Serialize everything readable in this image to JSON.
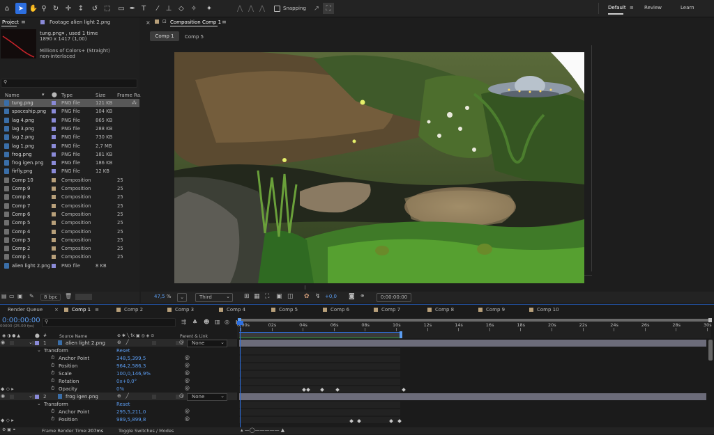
{
  "toolbar": {
    "snapping_label": "Snapping",
    "workspaces": [
      "Default",
      "Review",
      "Learn"
    ],
    "tools": [
      "home-icon",
      "selection-icon",
      "hand-icon",
      "zoom-icon",
      "orbit-icon",
      "move-icon",
      "dolly-icon",
      "rotate-icon",
      "marquee-icon",
      "rectangle-icon",
      "pen-icon",
      "type-icon",
      "brush-icon",
      "clone-icon",
      "eraser-icon",
      "roto-icon",
      "puppet-icon"
    ]
  },
  "project": {
    "title": "Project",
    "footage_tab": "Footage alien light 2.png",
    "info_name": "tung.png▾ , used 1 time",
    "info_dims": "1890 x 1417 (1,00)",
    "info_colors": "Millions of Colors+ (Straight)",
    "info_interlace": "non-interlaced",
    "search_placeholder": "",
    "columns": {
      "name": "Name",
      "type": "Type",
      "size": "Size",
      "frame_rate": "Frame Ra..."
    },
    "items": [
      {
        "name": "tung.png",
        "type": "PNG file",
        "size": "121 KB",
        "color": "#8a8ad8",
        "kind": "file",
        "selected": true
      },
      {
        "name": "spaceship.png",
        "type": "PNG file",
        "size": "104 KB",
        "color": "#8a8ad8",
        "kind": "file"
      },
      {
        "name": "lag 4.png",
        "type": "PNG file",
        "size": "865 KB",
        "color": "#8a8ad8",
        "kind": "file"
      },
      {
        "name": "lag 3.png",
        "type": "PNG file",
        "size": "288 KB",
        "color": "#8a8ad8",
        "kind": "file"
      },
      {
        "name": "lag 2.png",
        "type": "PNG file",
        "size": "730 KB",
        "color": "#8a8ad8",
        "kind": "file"
      },
      {
        "name": "lag 1.png",
        "type": "PNG file",
        "size": "2,7 MB",
        "color": "#8a8ad8",
        "kind": "file"
      },
      {
        "name": "frog.png",
        "type": "PNG file",
        "size": "181 KB",
        "color": "#8a8ad8",
        "kind": "file"
      },
      {
        "name": "frog igen.png",
        "type": "PNG file",
        "size": "186 KB",
        "color": "#8a8ad8",
        "kind": "file"
      },
      {
        "name": "firfly.png",
        "type": "PNG file",
        "size": "12 KB",
        "color": "#8a8ad8",
        "kind": "file"
      },
      {
        "name": "Comp 10",
        "type": "Composition",
        "size": "",
        "fps": "25",
        "color": "#b8a07a",
        "kind": "comp"
      },
      {
        "name": "Comp 9",
        "type": "Composition",
        "size": "",
        "fps": "25",
        "color": "#b8a07a",
        "kind": "comp"
      },
      {
        "name": "Comp 8",
        "type": "Composition",
        "size": "",
        "fps": "25",
        "color": "#b8a07a",
        "kind": "comp"
      },
      {
        "name": "Comp 7",
        "type": "Composition",
        "size": "",
        "fps": "25",
        "color": "#b8a07a",
        "kind": "comp"
      },
      {
        "name": "Comp 6",
        "type": "Composition",
        "size": "",
        "fps": "25",
        "color": "#b8a07a",
        "kind": "comp"
      },
      {
        "name": "Comp 5",
        "type": "Composition",
        "size": "",
        "fps": "25",
        "color": "#b8a07a",
        "kind": "comp"
      },
      {
        "name": "Comp 4",
        "type": "Composition",
        "size": "",
        "fps": "25",
        "color": "#b8a07a",
        "kind": "comp"
      },
      {
        "name": "Comp 3",
        "type": "Composition",
        "size": "",
        "fps": "25",
        "color": "#b8a07a",
        "kind": "comp"
      },
      {
        "name": "Comp 2",
        "type": "Composition",
        "size": "",
        "fps": "25",
        "color": "#b8a07a",
        "kind": "comp"
      },
      {
        "name": "Comp 1",
        "type": "Composition",
        "size": "",
        "fps": "25",
        "color": "#b8a07a",
        "kind": "comp"
      },
      {
        "name": "alien light 2.png",
        "type": "PNG file",
        "size": "8 KB",
        "color": "#8a8ad8",
        "kind": "file"
      }
    ],
    "bpc": "8 bpc"
  },
  "viewer": {
    "panel_title": "Composition Comp 1",
    "tabs": [
      "Comp 1",
      "Comp 5"
    ],
    "zoom": "47,5",
    "zoom_unit": "%",
    "view_mode": "Third",
    "exposure": "+0,0",
    "timecode": "0:00:00:00"
  },
  "timeline": {
    "render_queue": "Render Queue",
    "tabs": [
      {
        "label": "Comp 1",
        "active": true
      },
      {
        "label": "Comp 2"
      },
      {
        "label": "Comp 3"
      },
      {
        "label": "Comp 4"
      },
      {
        "label": "Comp 5"
      },
      {
        "label": "Comp 6"
      },
      {
        "label": "Comp 7"
      },
      {
        "label": "Comp 8"
      },
      {
        "label": "Comp 9"
      },
      {
        "label": "Comp 10"
      }
    ],
    "timecode": "0:00:00:00",
    "frame_info": "00000 (25.00 fps)",
    "col_source": "Source Name",
    "col_parent": "Parent & Link",
    "ruler": [
      "0:00s",
      "02s",
      "04s",
      "06s",
      "08s",
      "10s",
      "12s",
      "14s",
      "16s",
      "18s",
      "20s",
      "22s",
      "24s",
      "26s",
      "28s",
      "30s"
    ],
    "layers": [
      {
        "num": "1",
        "name": "alien light 2.png",
        "parent": "None"
      },
      {
        "num": "2",
        "name": "frog igen.png",
        "parent": "None"
      }
    ],
    "props1": [
      {
        "name": "Transform",
        "value": "Reset"
      },
      {
        "name": "Anchor Point",
        "value": "348,5,399,5"
      },
      {
        "name": "Position",
        "value": "964,2,586,3"
      },
      {
        "name": "Scale",
        "value": "100,0,146,9%"
      },
      {
        "name": "Rotation",
        "value": "0x+0,0°"
      },
      {
        "name": "Opacity",
        "value": "0%"
      }
    ],
    "props2": [
      {
        "name": "Transform",
        "value": "Reset"
      },
      {
        "name": "Anchor Point",
        "value": "295,5,211,0"
      },
      {
        "name": "Position",
        "value": "989,5,899,8"
      }
    ],
    "footer_render_label": "Frame Render Time:",
    "footer_render_value": "207ms",
    "footer_toggle": "Toggle Switches / Modes"
  }
}
